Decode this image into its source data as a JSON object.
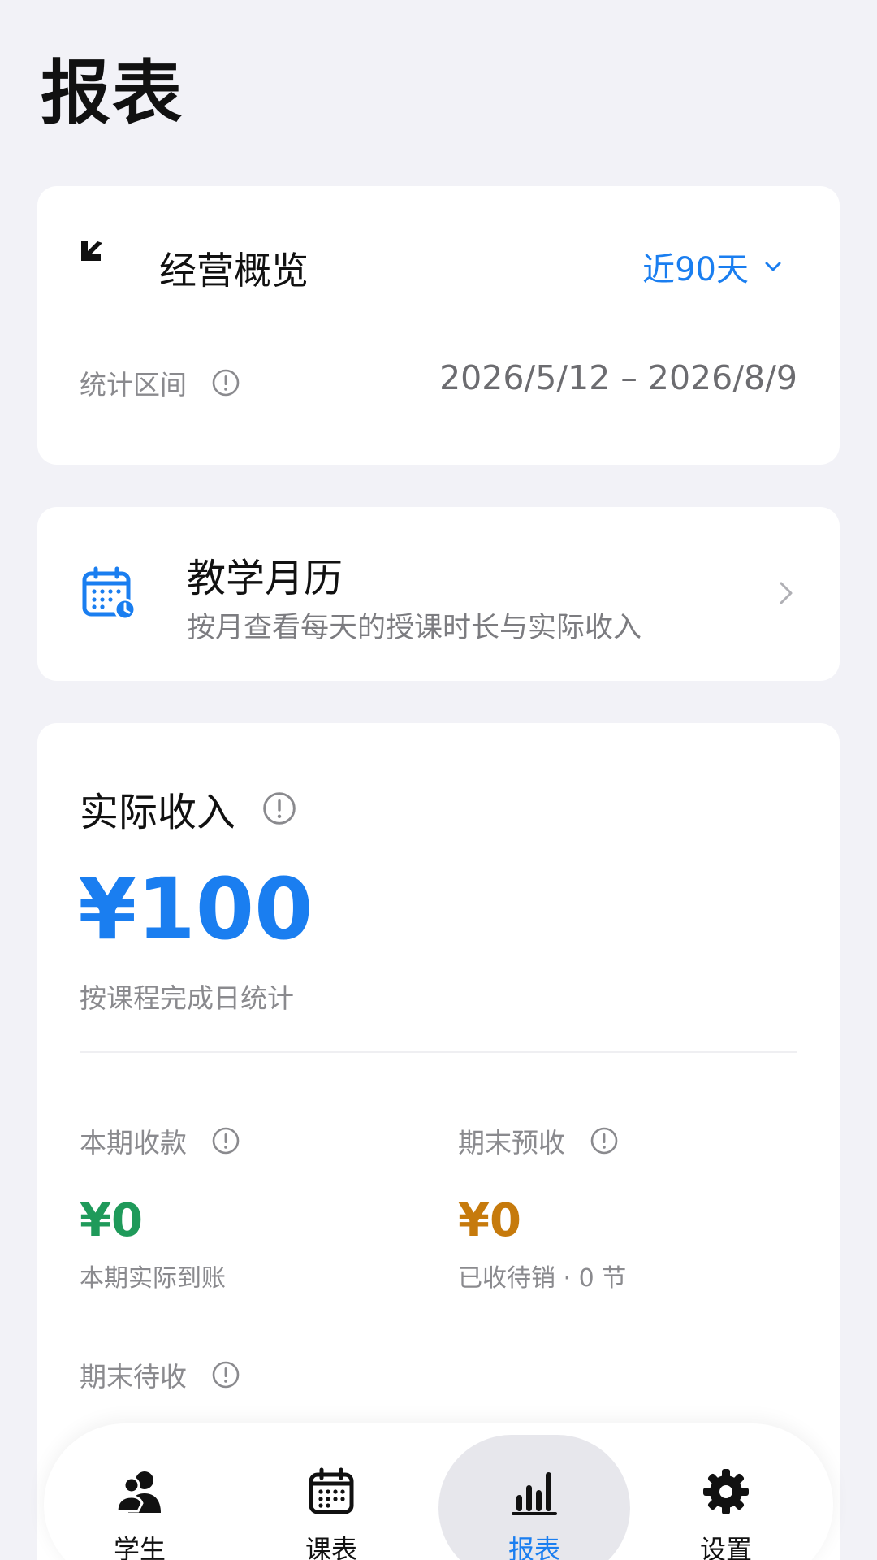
{
  "page": {
    "title": "报表"
  },
  "overview": {
    "title": "经营概览",
    "range_label": "近90天",
    "period_label": "统计区间",
    "period_value": "2026/5/12 – 2026/8/9"
  },
  "calendar": {
    "title": "教学月历",
    "subtitle": "按月查看每天的授课时长与实际收入"
  },
  "income": {
    "title": "实际收入",
    "value": "¥100",
    "note": "按课程完成日统计",
    "stats": [
      {
        "label": "本期收款",
        "value": "¥0",
        "note": "本期实际到账",
        "color": "#1f9a5a"
      },
      {
        "label": "期末预收",
        "value": "¥0",
        "note": "已收待销 · 0 节",
        "color": "#c67a0c"
      },
      {
        "label": "期末待收"
      }
    ]
  },
  "tabbar": {
    "tabs": [
      {
        "label": "学生",
        "icon": "people-icon"
      },
      {
        "label": "课表",
        "icon": "calendar-icon"
      },
      {
        "label": "报表",
        "icon": "bar-chart-icon",
        "active": true
      },
      {
        "label": "设置",
        "icon": "gear-icon"
      }
    ]
  },
  "colors": {
    "accent": "#1a7ef0",
    "background": "#f2f2f7",
    "card": "#ffffff"
  }
}
